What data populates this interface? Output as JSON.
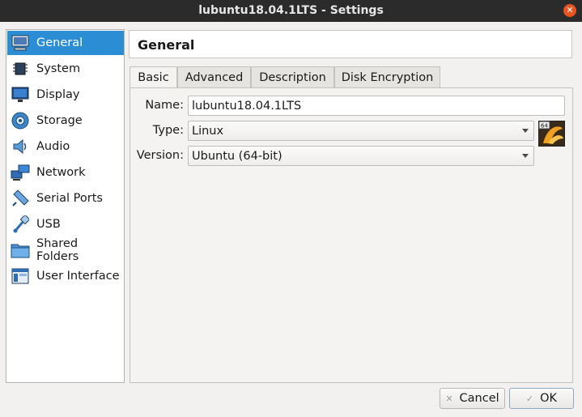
{
  "window": {
    "title": "lubuntu18.04.1LTS - Settings"
  },
  "sidebar": {
    "items": [
      {
        "label": "General",
        "icon": "general-icon"
      },
      {
        "label": "System",
        "icon": "system-chip-icon"
      },
      {
        "label": "Display",
        "icon": "display-monitor-icon"
      },
      {
        "label": "Storage",
        "icon": "storage-disk-icon"
      },
      {
        "label": "Audio",
        "icon": "audio-speaker-icon"
      },
      {
        "label": "Network",
        "icon": "network-icon"
      },
      {
        "label": "Serial Ports",
        "icon": "serial-port-icon"
      },
      {
        "label": "USB",
        "icon": "usb-icon"
      },
      {
        "label": "Shared Folders",
        "icon": "shared-folder-icon"
      },
      {
        "label": "User Interface",
        "icon": "user-interface-icon"
      }
    ],
    "selected": "General"
  },
  "header": {
    "title": "General"
  },
  "tabs": [
    {
      "label": "Basic",
      "active": true
    },
    {
      "label": "Advanced",
      "active": false
    },
    {
      "label": "Description",
      "active": false
    },
    {
      "label": "Disk Encryption",
      "active": false
    }
  ],
  "form": {
    "name_label": "Name:",
    "name_value": "lubuntu18.04.1LTS",
    "type_label": "Type:",
    "type_value": "Linux",
    "version_label": "Version:",
    "version_value": "Ubuntu (64-bit)",
    "os_badge": "64"
  },
  "buttons": {
    "cancel": "Cancel",
    "ok": "OK"
  },
  "colors": {
    "selection": "#2b8ed5",
    "titlebar": "#2b2b2b",
    "close": "#e95420"
  }
}
